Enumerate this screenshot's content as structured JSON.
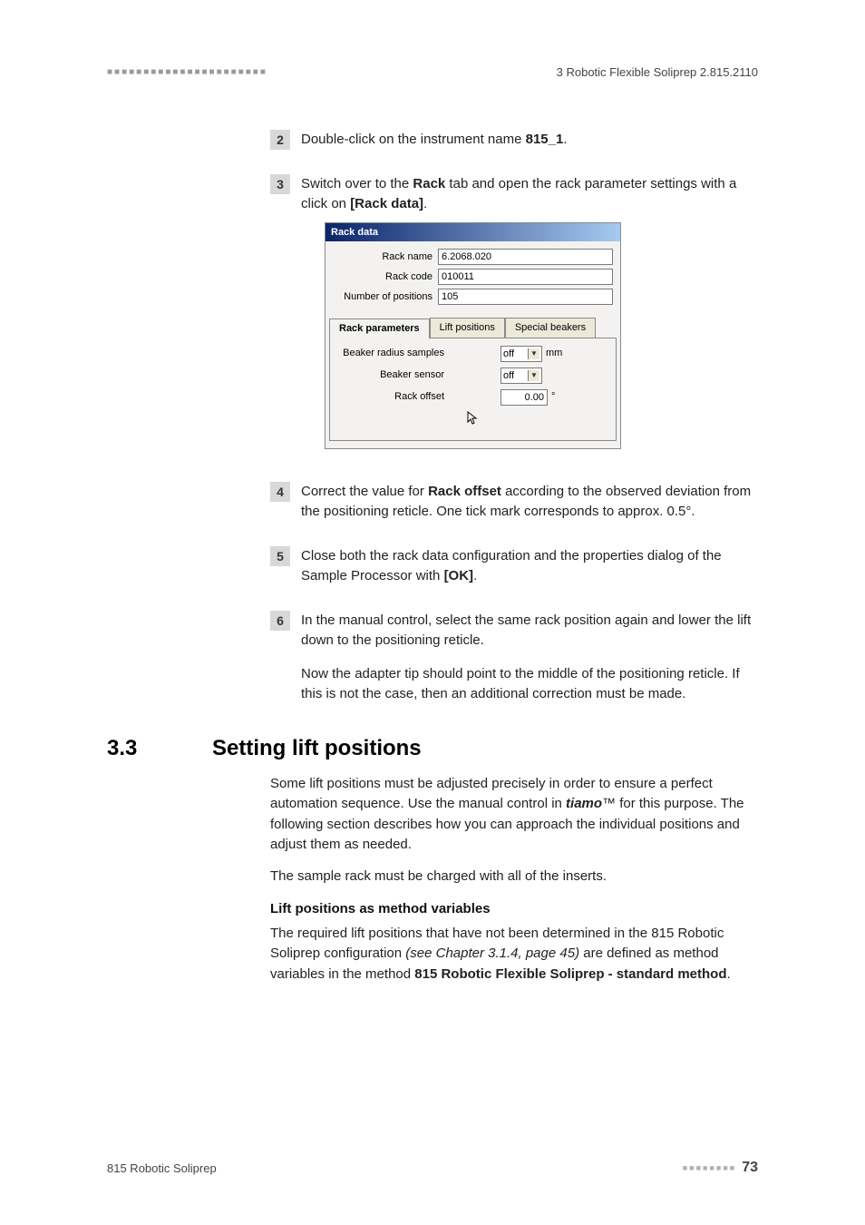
{
  "header": {
    "left_dashes": "■■■■■■■■■■■■■■■■■■■■■■",
    "right": "3 Robotic Flexible Soliprep 2.815.2110"
  },
  "steps": {
    "s2": {
      "num": "2",
      "text_a": "Double-click on the instrument name ",
      "bold_a": "815_1",
      "text_b": "."
    },
    "s3": {
      "num": "3",
      "text_a": "Switch over to the ",
      "bold_a": "Rack",
      "text_b": " tab and open the rack parameter settings with a click on ",
      "bold_b": "[Rack data]",
      "text_c": "."
    },
    "s4": {
      "num": "4",
      "text_a": "Correct the value for ",
      "bold_a": "Rack offset",
      "text_b": " according to the observed deviation from the positioning reticle. One tick mark corresponds to approx. 0.5°."
    },
    "s5": {
      "num": "5",
      "text_a": "Close both the rack data configuration and the properties dialog of the Sample Processor with ",
      "bold_a": "[OK]",
      "text_b": "."
    },
    "s6": {
      "num": "6",
      "text_a": "In the manual control, select the same rack position again and lower the lift down to the positioning reticle.",
      "after": "Now the adapter tip should point to the middle of the positioning reticle. If this is not the case, then an additional correction must be made."
    }
  },
  "rack": {
    "title": "Rack data",
    "rack_name_label": "Rack name",
    "rack_name_value": "6.2068.020",
    "rack_code_label": "Rack code",
    "rack_code_value": "010011",
    "num_pos_label": "Number of positions",
    "num_pos_value": "105",
    "tabs": {
      "params": "Rack parameters",
      "lift": "Lift positions",
      "beakers": "Special beakers"
    },
    "beaker_radius_label": "Beaker radius samples",
    "beaker_radius_value": "off",
    "beaker_radius_unit": "mm",
    "beaker_sensor_label": "Beaker sensor",
    "beaker_sensor_value": "off",
    "rack_offset_label": "Rack offset",
    "rack_offset_value": "0.00",
    "rack_offset_unit": "°",
    "cursor_glyph": "↖"
  },
  "section": {
    "num": "3.3",
    "title": "Setting lift positions",
    "p1a": "Some lift positions must be adjusted precisely in order to ensure a perfect automation sequence. Use the manual control in ",
    "p1_bold": "tiamo",
    "p1_tm": "™",
    "p1b": " for this purpose. The following section describes how you can approach the individual positions and adjust them as needed.",
    "p2": "The sample rack must be charged with all of the inserts.",
    "subhead": "Lift positions as method variables",
    "p3a": "The required lift positions that have not been determined in the 815 Robotic Soliprep configuration ",
    "p3_ital": "(see Chapter 3.1.4, page 45)",
    "p3b": " are defined as method variables in the method ",
    "p3_bold": "815 Robotic Flexible Soliprep - standard method",
    "p3c": "."
  },
  "footer": {
    "left": "815 Robotic Soliprep",
    "dashes": "■■■■■■■■",
    "page": "73"
  }
}
